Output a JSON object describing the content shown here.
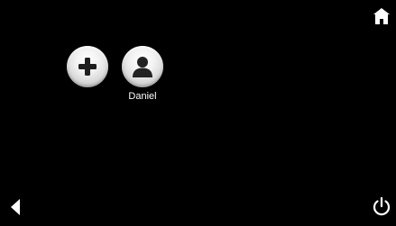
{
  "header": {
    "home_icon": "home-icon"
  },
  "profiles": {
    "add": {
      "icon": "plus-icon"
    },
    "users": [
      {
        "name": "Daniel",
        "icon": "person-icon"
      }
    ]
  },
  "footer": {
    "back_icon": "triangle-left-icon",
    "power_icon": "power-icon"
  },
  "colors": {
    "background": "#000000",
    "text": "#ffffff",
    "icon_dark": "#222222"
  }
}
